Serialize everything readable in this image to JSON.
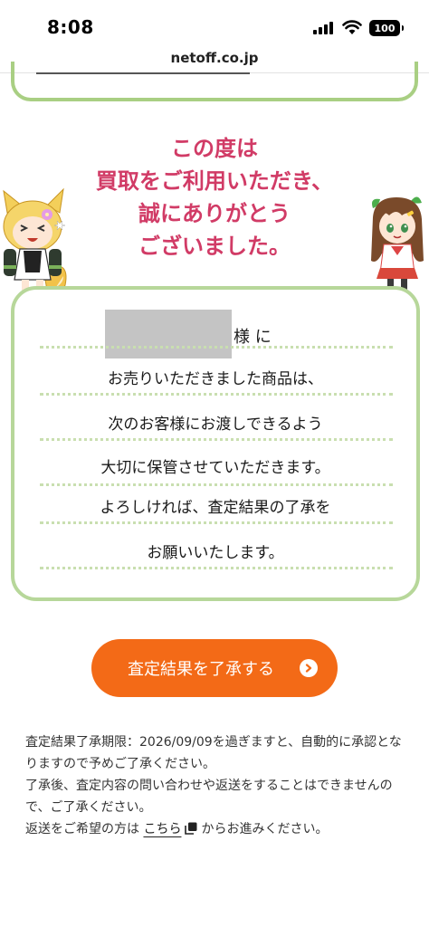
{
  "status_bar": {
    "time": "8:08",
    "battery": "100"
  },
  "browser": {
    "url": "netoff.co.jp"
  },
  "thanks": {
    "lines": [
      "この度は",
      "買取をご利用いただき、",
      "誠にありがとう",
      "ございました。"
    ]
  },
  "message": {
    "honorific": "様 に",
    "lines": [
      "お売りいただきました商品は、",
      "次のお客様にお渡しできるよう",
      "大切に保管させていただきます。",
      "よろしければ、査定結果の了承を",
      "お願いいたします。"
    ]
  },
  "cta": {
    "label": "査定結果を了承する"
  },
  "notes": {
    "line1": "査定結果了承期限：2026/09/09を過ぎますと、自動的に承認となりますので予めご了承ください。",
    "line2": "了承後、査定内容の問い合わせや返送をすることはできませんので、ご了承ください。",
    "line3_prefix": "返送をご希望の方は",
    "line3_link": "こちら",
    "line3_suffix": "からお進みください。"
  },
  "colors": {
    "accent": "#f36a17",
    "heading": "#d13b66",
    "frame": "#b7d79a"
  }
}
